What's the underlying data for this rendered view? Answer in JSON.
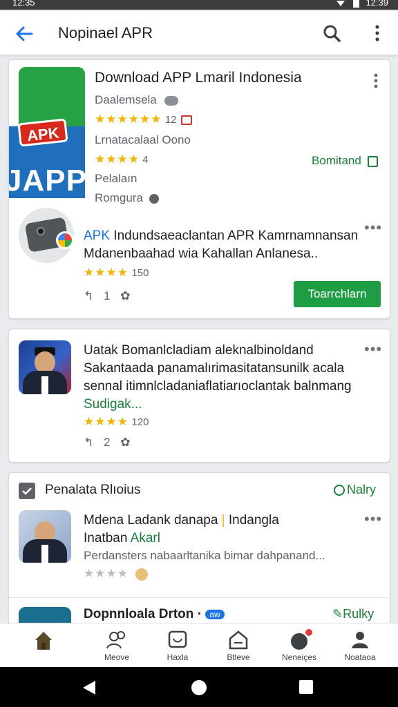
{
  "status_bar": {
    "time_left": "12:35",
    "time_right": "12:39"
  },
  "app_bar": {
    "title": "Nopinael APR"
  },
  "card1": {
    "icon_badge": "APK",
    "icon_label": "JAPP",
    "title": "Download APP Lmaril Indonesia",
    "developer": "Daalemsela",
    "rating1_count": "12",
    "category": "Lrnatacalaal Oono",
    "rating2_count": "4",
    "download_link": "Bomitand",
    "line3": "Pelalaın",
    "line4": "Romgura",
    "promo_highlight": "APK",
    "promo_text_1": " Indundsaeaclantan APR Kamrnamnansan",
    "promo_text_2": "Mdanenbaahad wia Kahallan Anlanesa..",
    "promo_rating": "150",
    "promo_likes": "1",
    "install_label": "Toarrchlarn"
  },
  "card2": {
    "line1": "Uatak Bomanlcladiam aleknalbinoldand",
    "line2": "Sakantaada panamalırimasitatansunilk acala",
    "line3": "sennal itimnlcladaniaflatiarıoclantak balnmang",
    "link": "Sudigak...",
    "rating": "120",
    "likes": "2"
  },
  "card3": {
    "section_title": "Penalata Rlıoius",
    "section_action": "Nalry",
    "item1_title": "Mdena Ladank danapa",
    "item1_title_b": "Indangla",
    "item1_title_line2": "Inatban",
    "item1_title_accent": "Akarl",
    "item1_desc": "Perdansters nabaarltanika bimar dahpanand...",
    "item2_title": "Dopnnloala Drton ·",
    "item2_badge": "aw",
    "item2_action": "Rulky"
  },
  "bottom_nav": [
    {
      "label": ""
    },
    {
      "label": "Meove"
    },
    {
      "label": "Haxla"
    },
    {
      "label": "Btleve"
    },
    {
      "label": "Neneiçes"
    },
    {
      "label": "Noataoa"
    }
  ],
  "colors": {
    "accent_blue": "#1a73e8",
    "install_green": "#1e9e44",
    "link_green": "#188038",
    "star_yellow": "#f2b400"
  },
  "icons": [
    "back-arrow-icon",
    "search-icon",
    "overflow-menu-icon",
    "home-icon",
    "people-icon",
    "chat-icon",
    "store-icon",
    "notifications-icon",
    "profile-icon"
  ]
}
